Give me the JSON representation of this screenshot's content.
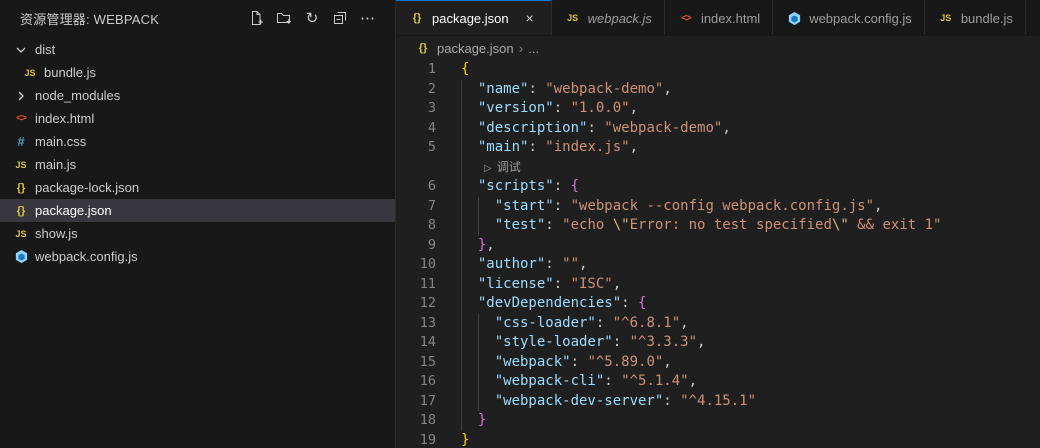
{
  "sidebar": {
    "title": "资源管理器: WEBPACK",
    "toolbar": [
      "new-file",
      "new-folder",
      "refresh",
      "collapse-folders",
      "more-actions"
    ],
    "tree": [
      {
        "label": "dist",
        "kind": "folder",
        "expanded": true,
        "nested": false
      },
      {
        "label": "bundle.js",
        "kind": "file",
        "icon": "js",
        "nested": true
      },
      {
        "label": "node_modules",
        "kind": "folder",
        "expanded": false,
        "nested": false
      },
      {
        "label": "index.html",
        "kind": "file",
        "icon": "html",
        "nested": false
      },
      {
        "label": "main.css",
        "kind": "file",
        "icon": "css",
        "nested": false
      },
      {
        "label": "main.js",
        "kind": "file",
        "icon": "js",
        "nested": false
      },
      {
        "label": "package-lock.json",
        "kind": "file",
        "icon": "json",
        "nested": false
      },
      {
        "label": "package.json",
        "kind": "file",
        "icon": "json",
        "nested": false,
        "selected": true
      },
      {
        "label": "show.js",
        "kind": "file",
        "icon": "js",
        "nested": false
      },
      {
        "label": "webpack.config.js",
        "kind": "file",
        "icon": "webpack",
        "nested": false
      }
    ]
  },
  "tabs": [
    {
      "label": "package.json",
      "icon": "json",
      "active": true,
      "close": "×"
    },
    {
      "label": "webpack.js",
      "icon": "js",
      "preview": true
    },
    {
      "label": "index.html",
      "icon": "html"
    },
    {
      "label": "webpack.config.js",
      "icon": "webpack"
    },
    {
      "label": "bundle.js",
      "icon": "js"
    }
  ],
  "breadcrumb": {
    "icon": "json",
    "file": "package.json",
    "separator": "›",
    "more": "..."
  },
  "icon_glyphs": {
    "js": "JS",
    "json": "{}",
    "html": "<>",
    "css": "#"
  },
  "editor": {
    "codelens": {
      "after_line": 5,
      "play_icon": "▷",
      "label": "调试"
    },
    "lines": [
      {
        "num": 1,
        "tokens": [
          [
            "b1",
            "{"
          ]
        ]
      },
      {
        "num": 2,
        "tokens": [
          [
            "pln",
            "  "
          ],
          [
            "key",
            "\"name\""
          ],
          [
            "pln",
            ": "
          ],
          [
            "str",
            "\"webpack-demo\""
          ],
          [
            "pln",
            ","
          ]
        ]
      },
      {
        "num": 3,
        "tokens": [
          [
            "pln",
            "  "
          ],
          [
            "key",
            "\"version\""
          ],
          [
            "pln",
            ": "
          ],
          [
            "str",
            "\"1.0.0\""
          ],
          [
            "pln",
            ","
          ]
        ]
      },
      {
        "num": 4,
        "tokens": [
          [
            "pln",
            "  "
          ],
          [
            "key",
            "\"description\""
          ],
          [
            "pln",
            ": "
          ],
          [
            "str",
            "\"webpack-demo\""
          ],
          [
            "pln",
            ","
          ]
        ]
      },
      {
        "num": 5,
        "tokens": [
          [
            "pln",
            "  "
          ],
          [
            "key",
            "\"main\""
          ],
          [
            "pln",
            ": "
          ],
          [
            "str",
            "\"index.js\""
          ],
          [
            "pln",
            ","
          ]
        ]
      },
      {
        "num": 6,
        "tokens": [
          [
            "pln",
            "  "
          ],
          [
            "key",
            "\"scripts\""
          ],
          [
            "pln",
            ": "
          ],
          [
            "b2",
            "{"
          ]
        ]
      },
      {
        "num": 7,
        "tokens": [
          [
            "pln",
            "    "
          ],
          [
            "key",
            "\"start\""
          ],
          [
            "pln",
            ": "
          ],
          [
            "str",
            "\"webpack --config webpack.config.js\""
          ],
          [
            "pln",
            ","
          ]
        ]
      },
      {
        "num": 8,
        "tokens": [
          [
            "pln",
            "    "
          ],
          [
            "key",
            "\"test\""
          ],
          [
            "pln",
            ": "
          ],
          [
            "str",
            "\"echo "
          ],
          [
            "esc",
            "\\\""
          ],
          [
            "str",
            "Error: no test specified"
          ],
          [
            "esc",
            "\\\""
          ],
          [
            "str",
            " && exit 1\""
          ]
        ]
      },
      {
        "num": 9,
        "tokens": [
          [
            "pln",
            "  "
          ],
          [
            "b2",
            "}"
          ],
          [
            "pln",
            ","
          ]
        ]
      },
      {
        "num": 10,
        "tokens": [
          [
            "pln",
            "  "
          ],
          [
            "key",
            "\"author\""
          ],
          [
            "pln",
            ": "
          ],
          [
            "str",
            "\"\""
          ],
          [
            "pln",
            ","
          ]
        ]
      },
      {
        "num": 11,
        "tokens": [
          [
            "pln",
            "  "
          ],
          [
            "key",
            "\"license\""
          ],
          [
            "pln",
            ": "
          ],
          [
            "str",
            "\"ISC\""
          ],
          [
            "pln",
            ","
          ]
        ]
      },
      {
        "num": 12,
        "tokens": [
          [
            "pln",
            "  "
          ],
          [
            "key",
            "\"devDependencies\""
          ],
          [
            "pln",
            ": "
          ],
          [
            "b2",
            "{"
          ]
        ]
      },
      {
        "num": 13,
        "tokens": [
          [
            "pln",
            "    "
          ],
          [
            "key",
            "\"css-loader\""
          ],
          [
            "pln",
            ": "
          ],
          [
            "str",
            "\"^6.8.1\""
          ],
          [
            "pln",
            ","
          ]
        ]
      },
      {
        "num": 14,
        "tokens": [
          [
            "pln",
            "    "
          ],
          [
            "key",
            "\"style-loader\""
          ],
          [
            "pln",
            ": "
          ],
          [
            "str",
            "\"^3.3.3\""
          ],
          [
            "pln",
            ","
          ]
        ]
      },
      {
        "num": 15,
        "tokens": [
          [
            "pln",
            "    "
          ],
          [
            "key",
            "\"webpack\""
          ],
          [
            "pln",
            ": "
          ],
          [
            "str",
            "\"^5.89.0\""
          ],
          [
            "pln",
            ","
          ]
        ]
      },
      {
        "num": 16,
        "tokens": [
          [
            "pln",
            "    "
          ],
          [
            "key",
            "\"webpack-cli\""
          ],
          [
            "pln",
            ": "
          ],
          [
            "str",
            "\"^5.1.4\""
          ],
          [
            "pln",
            ","
          ]
        ]
      },
      {
        "num": 17,
        "tokens": [
          [
            "pln",
            "    "
          ],
          [
            "key",
            "\"webpack-dev-server\""
          ],
          [
            "pln",
            ": "
          ],
          [
            "str",
            "\"^4.15.1\""
          ]
        ]
      },
      {
        "num": 18,
        "tokens": [
          [
            "pln",
            "  "
          ],
          [
            "b2",
            "}"
          ]
        ]
      },
      {
        "num": 19,
        "tokens": [
          [
            "b1",
            "}"
          ]
        ]
      }
    ]
  },
  "colors": {
    "accent_tab_border": "#0078d4",
    "editor_bg": "#1f1f1f",
    "sidebar_bg": "#181818",
    "selection_bg": "#37373d",
    "json_key": "#9cdcfe",
    "json_string": "#ce9178",
    "bracket_level1": "#ffd700",
    "bracket_level2": "#da70d6",
    "string_escape": "#d7ba7d",
    "js_icon": "#d6c64a",
    "html_icon": "#e44d26",
    "css_icon": "#519aba",
    "webpack_icon_outer": "#8ed6fb",
    "webpack_icon_inner": "#1c78c0"
  }
}
